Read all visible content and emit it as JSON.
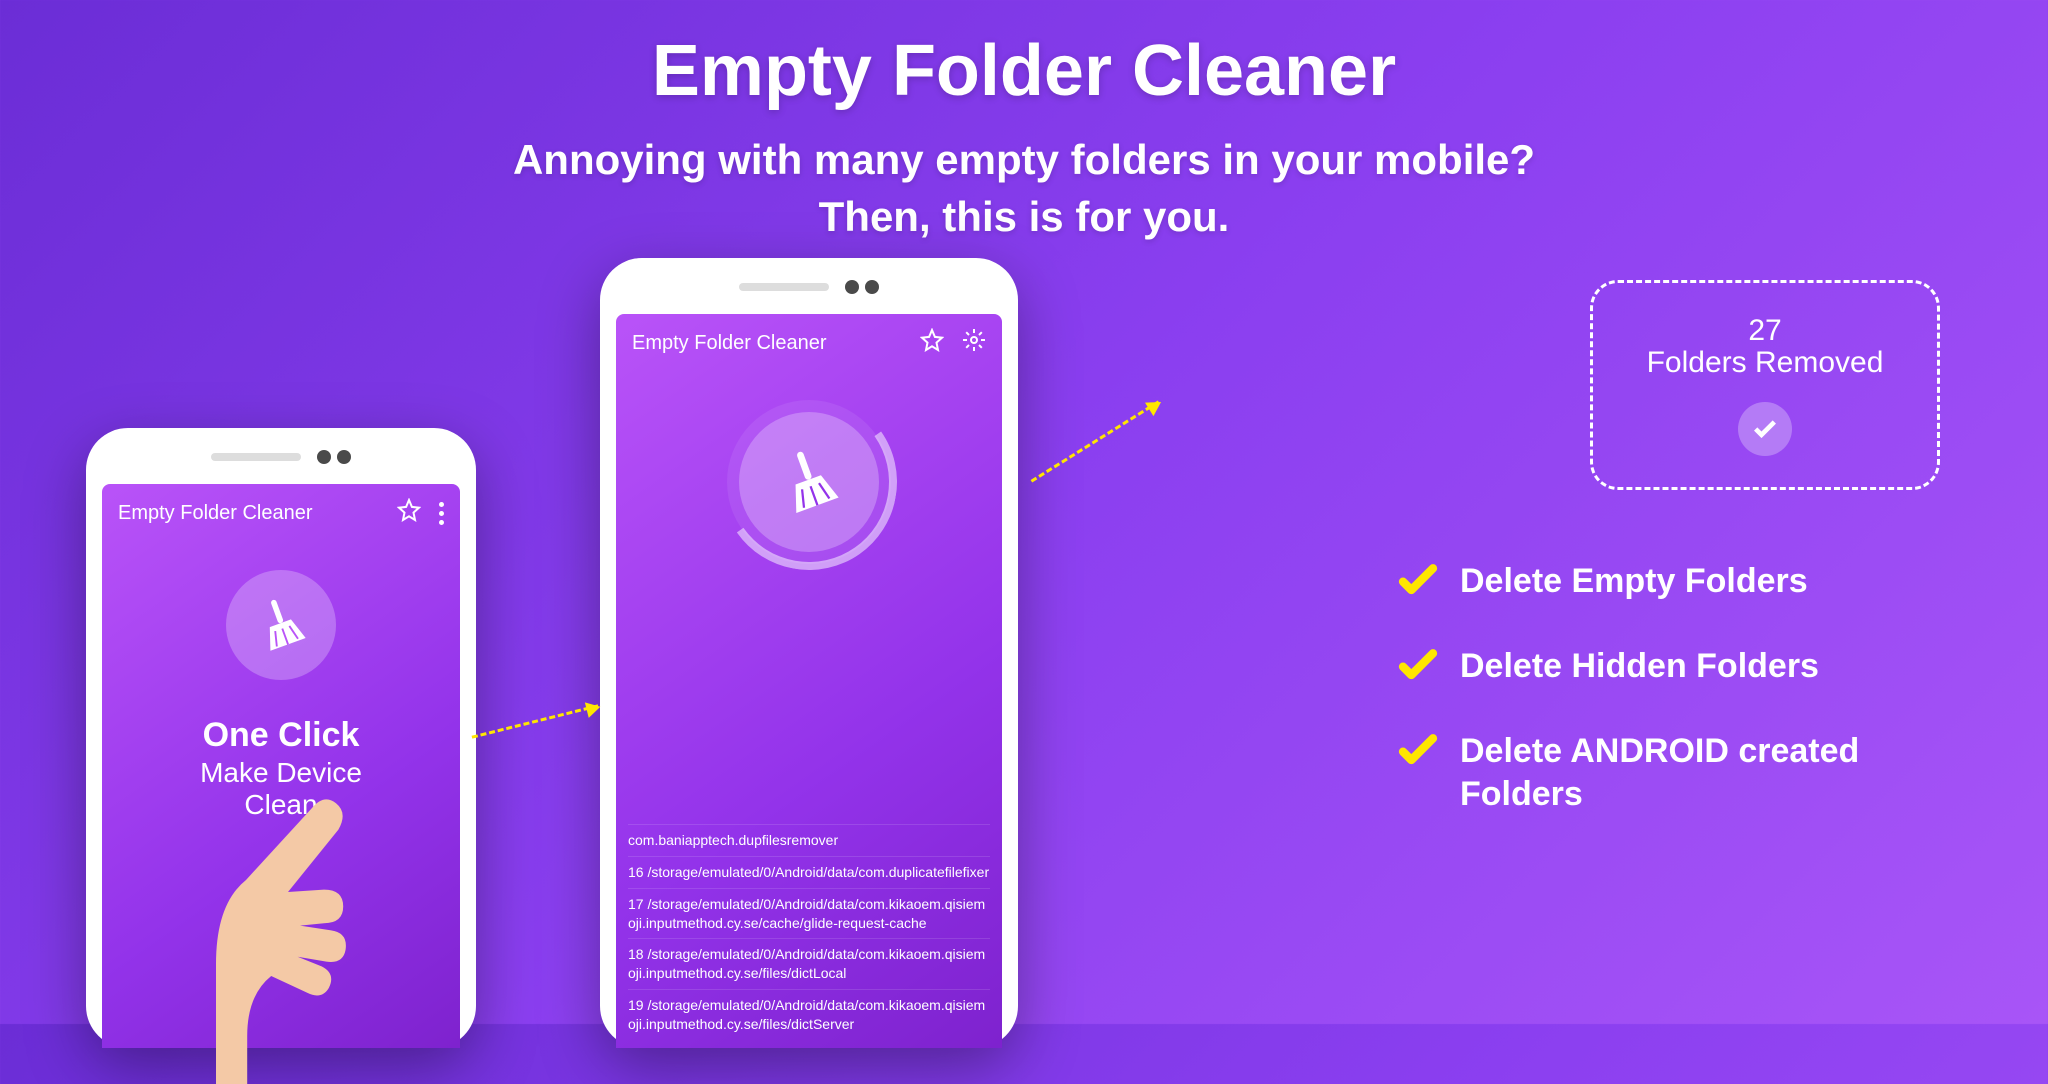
{
  "hero": {
    "title": "Empty Folder Cleaner",
    "subtitle_l1": "Annoying with many empty folders in your mobile?",
    "subtitle_l2": "Then, this is for you."
  },
  "phone_left": {
    "appbar_title": "Empty Folder Cleaner",
    "caption_l1": "One Click",
    "caption_l2": "Make Device",
    "caption_l3": "Clean"
  },
  "phone_center": {
    "appbar_title": "Empty Folder Cleaner",
    "log_items": [
      "com.baniapptech.dupfilesremover",
      "16 /storage/emulated/0/Android/data/com.duplicatefilefixer",
      "17 /storage/emulated/0/Android/data/com.kikaoem.qisiemoji.inputmethod.cy.se/cache/glide-request-cache",
      "18 /storage/emulated/0/Android/data/com.kikaoem.qisiemoji.inputmethod.cy.se/files/dictLocal",
      "19 /storage/emulated/0/Android/data/com.kikaoem.qisiemoji.inputmethod.cy.se/files/dictServer"
    ]
  },
  "result": {
    "count": "27",
    "label": "Folders Removed"
  },
  "features": [
    "Delete Empty Folders",
    "Delete Hidden Folders",
    "Delete ANDROID created Folders"
  ]
}
